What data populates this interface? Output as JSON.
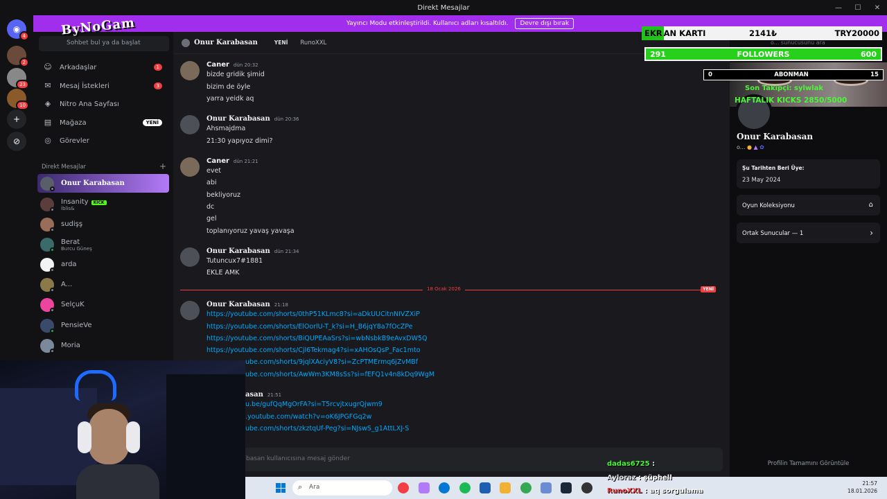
{
  "window": {
    "title": "Direkt Mesajlar",
    "controls": [
      "—",
      "☐",
      "✕"
    ]
  },
  "banner": {
    "text": "Yayıncı Modu etkinleştirildi. Kullanıcı adları kısaltıldı.",
    "button": "Devre dışı bırak"
  },
  "servers": [
    {
      "icon": "discord-logo-icon",
      "badge": "4"
    },
    {
      "icon": "server-avatar-icon",
      "badge": "2"
    },
    {
      "icon": "server-avatar-icon",
      "badge": "23"
    },
    {
      "icon": "server-avatar-icon",
      "badge": "10"
    },
    {
      "icon": "add-server-icon",
      "badge": ""
    },
    {
      "icon": "explore-icon",
      "badge": ""
    }
  ],
  "search": {
    "placeholder": "Sohbet bul ya da başlat"
  },
  "nav": [
    {
      "label": "Arkadaşlar",
      "count": "1",
      "icon": "friends-icon"
    },
    {
      "label": "Mesaj İstekleri",
      "count": "3",
      "icon": "mail-icon"
    },
    {
      "label": "Nitro Ana Sayfası",
      "count": "",
      "icon": "nitro-icon"
    },
    {
      "label": "Mağaza",
      "count": "",
      "badge": "YENİ",
      "icon": "shop-icon"
    },
    {
      "label": "Görevler",
      "count": "",
      "icon": "quests-icon"
    }
  ],
  "dm_header": "Direkt Mesajlar",
  "dms": [
    {
      "name": "Onur Karabasan",
      "sub": "",
      "online": false,
      "active": true
    },
    {
      "name": "Insanity",
      "sub": "İblis&",
      "online": false,
      "kick": "KICK"
    },
    {
      "name": "sudişş",
      "sub": "",
      "online": false
    },
    {
      "name": "Berat",
      "sub": "Burcu Güneş",
      "online": true
    },
    {
      "name": "arda",
      "sub": "",
      "online": false
    },
    {
      "name": "A...",
      "sub": "",
      "online": false
    },
    {
      "name": "SelçuK",
      "sub": "",
      "online": false
    },
    {
      "name": "PensieVe",
      "sub": "",
      "online": true
    },
    {
      "name": "Moria",
      "sub": "",
      "online": false
    }
  ],
  "chat_header": {
    "name": "Onur Karabasan",
    "new_label": "YENİ",
    "other": "RunoXXL"
  },
  "messages": [
    {
      "author": "Caner",
      "time": "dün 20:32",
      "lines": [
        "bizde gridik şimid",
        "bizim de öyle",
        "yarra yeidk aq"
      ]
    },
    {
      "author": "Onur Karabasan",
      "time": "dün 20:36",
      "lines": [
        "Ahsmajdma",
        "21:30 yapıyoz dimi?"
      ]
    },
    {
      "author": "Caner",
      "time": "dün 21:21",
      "lines": [
        "evet",
        "abi",
        "bekliyoruz",
        "dc",
        "gel",
        "toplanıyoruz yavaş yavaşa"
      ]
    },
    {
      "author": "Onur Karabasan",
      "time": "dün 21:34",
      "lines": [
        "Tutuncux7#1881",
        "EKLE AMK"
      ]
    },
    {
      "author": "Onur Karabasan",
      "time": "21:18",
      "lines": [
        "https://youtube.com/shorts/0thP51KLmc8?si=aDkUUCitnNIVZXiP",
        "https://youtube.com/shorts/ElOorlU-T_k?si=H_B6jqY8a7fOcZPe",
        "https://youtube.com/shorts/BiQUPEAaSrs?si=wbNsbkB9eAvxDW5Q",
        "https://youtube.com/shorts/Cjl6Tekmag4?si=xAHOsQsP_Fac1mto",
        "ube.com/shorts/9jqlXAciyV8?si=ZcPTMErmq6jZvMBf",
        "ube.com/shorts/AwWm3KM8sSs?si=fEFQ1v4n8kDq9WgM"
      ]
    },
    {
      "author": "asan",
      "time": "21:51",
      "lines": [
        "u.be/gufQqMgOrFA?si=T5rcvjtxugrQjwm9",
        ".youtube.com/watch?v=oK6JPGFGq2w",
        "ube.com/shorts/zkztqUf-Peg?si=NJswS_g1AttLXJ-S"
      ]
    }
  ],
  "divider": {
    "date": "18 Ocak 2026",
    "new": "YENİ"
  },
  "composer": {
    "placeholder": "basan kullanıcısına mesaj gönder"
  },
  "profile": {
    "name": "Onur Karabasan",
    "sub": "o...",
    "member_label": "Şu Tarihten Beri Üye:",
    "member_date": "23 May 2024",
    "collection": "Oyun Koleksiyonu",
    "mutual": "Ortak Sunucular — 1",
    "view_full": "Profilin Tamamını Görüntüle",
    "search_placeholder": "o... sunucusunu ara"
  },
  "overlay": {
    "logo": "ByNoGam",
    "ekran_green": "EKR",
    "ekran_rest": "AN KARTI",
    "ekran_mid": "2141₺",
    "ekran_right": "TRY20000",
    "followers_left": "291",
    "followers_label": "FOLLOWERS",
    "followers_right": "600",
    "abone_left": "0",
    "abone_label": "ABONMAN",
    "abone_right": "15",
    "son_takipci": "Son Takipçi: sylwlak",
    "hedef": "HAFTALIK KICKS 2850/5000",
    "followers_progress": 0.485,
    "ekran_progress": 0.107
  },
  "stream_chat": [
    {
      "user": "dadas6725",
      "sep": " : ",
      "msg": "",
      "color": "#4df53a"
    },
    {
      "user": "Ayloraz",
      "sep": " : ",
      "msg": "şüphell",
      "color": "#dbdee1"
    },
    {
      "user": "RunoXXL",
      "sep": " : ",
      "msg": "aq sorgulama",
      "color": "#f23f43"
    }
  ],
  "taskbar": {
    "search": "Ara",
    "time": "21:57",
    "date": "18.01.2026"
  }
}
